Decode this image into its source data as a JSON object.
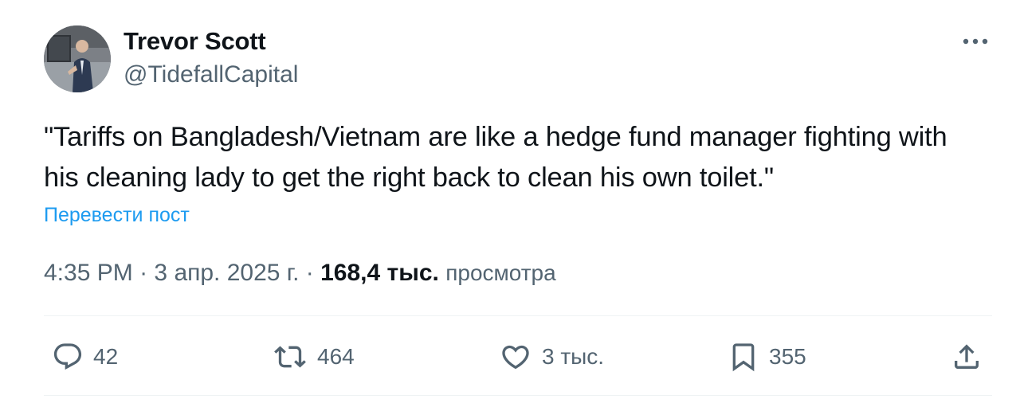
{
  "author": {
    "name": "Trevor Scott",
    "handle": "@TidefallCapital",
    "avatar": "avatar-photo"
  },
  "tweet": {
    "text": "\"Tariffs on Bangladesh/Vietnam are like a hedge fund manager fighting with his cleaning lady to get the right back to clean his own toilet.\"",
    "translate_label": "Перевести пост"
  },
  "meta": {
    "time": "4:35 PM",
    "separator": "·",
    "date": "3 апр. 2025 г.",
    "views_count": "168,4 тыс.",
    "views_label": "просмотра"
  },
  "actions": {
    "reply": {
      "icon": "reply-icon",
      "count": "42"
    },
    "retweet": {
      "icon": "retweet-icon",
      "count": "464"
    },
    "like": {
      "icon": "heart-icon",
      "count": "3 тыс."
    },
    "bookmark": {
      "icon": "bookmark-icon",
      "count": "355"
    },
    "share": {
      "icon": "share-icon"
    }
  },
  "menu": {
    "icon": "more-options-icon"
  },
  "colors": {
    "text_primary": "#0f1419",
    "text_secondary": "#536471",
    "link": "#1d9bf0",
    "divider": "#eff3f4"
  }
}
